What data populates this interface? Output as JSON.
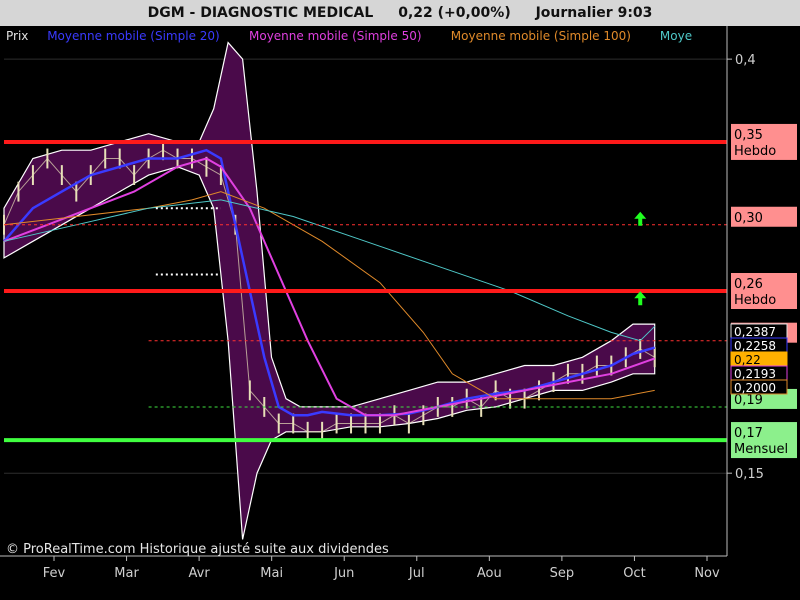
{
  "header": {
    "ticker": "DGM - DIAGNOSTIC MEDICAL",
    "price_change": "0,22 (+0,00%)",
    "interval_time": "Journalier  9:03"
  },
  "legend": [
    {
      "label": "Prix",
      "color": "#e0e0e0"
    },
    {
      "label": "Moyenne mobile (Simple 20)",
      "color": "#3a3aff"
    },
    {
      "label": "Moyenne mobile (Simple 50)",
      "color": "#e040e0"
    },
    {
      "label": "Moyenne mobile (Simple 100)",
      "color": "#e08a2a"
    },
    {
      "label": "Moye",
      "color": "#4fc8c8"
    }
  ],
  "copyright": "© ProRealTime.com Historique ajusté suite aux dividendes",
  "chart_data": {
    "type": "line",
    "ylim": [
      0.1,
      0.42
    ],
    "y_ticks": [
      {
        "value": 0.4,
        "label": "0,4"
      },
      {
        "value": 0.15,
        "label": "0,15"
      }
    ],
    "x_ticks": [
      "Fev",
      "Mar",
      "Avr",
      "Mai",
      "Jun",
      "Jul",
      "Aou",
      "Sep",
      "Oct",
      "Nov"
    ],
    "levels": [
      {
        "value": 0.35,
        "label": "0,35",
        "sublabel": "Hebdo",
        "style": "solid",
        "color": "#ff1a1a",
        "tag_bg": "#ff8f8f"
      },
      {
        "value": 0.3,
        "label": "0,30",
        "sublabel": "",
        "style": "dotted",
        "color": "#ff3030",
        "tag_bg": "#ff8f8f"
      },
      {
        "value": 0.26,
        "label": "0,26",
        "sublabel": "Hebdo",
        "style": "solid",
        "color": "#ff1a1a",
        "tag_bg": "#ff8f8f"
      },
      {
        "value": 0.23,
        "label": "0,23",
        "sublabel": "",
        "style": "dotted",
        "color": "#ff3030",
        "tag_bg": "#ff8f8f"
      },
      {
        "value": 0.19,
        "label": "0,19",
        "sublabel": "",
        "style": "dotted",
        "color": "#40e040",
        "tag_bg": "#8cf08c"
      },
      {
        "value": 0.17,
        "label": "0,17",
        "sublabel": "Mensuel",
        "style": "solid",
        "color": "#40ff40",
        "tag_bg": "#8cf08c"
      }
    ],
    "white_dotted": [
      {
        "value": 0.31,
        "from": 0.21,
        "to": 0.3
      },
      {
        "value": 0.27,
        "from": 0.21,
        "to": 0.3
      }
    ],
    "value_tags": [
      {
        "value": 0.2387,
        "label": "0,2387",
        "bg": "#000",
        "color": "#ffffff",
        "border": "#e0e0e0"
      },
      {
        "value": 0.2258,
        "label": "0,2258",
        "bg": "#000",
        "color": "#ffffff",
        "border": "#3a3aff"
      },
      {
        "value": 0.22,
        "label": "0,22",
        "bg": "#ffb000",
        "color": "#000000",
        "border": "#ffb000"
      },
      {
        "value": 0.2193,
        "label": "0,2193",
        "bg": "#000",
        "color": "#ffffff",
        "border": "#e040e0"
      },
      {
        "value": 0.2,
        "label": "0,2000",
        "bg": "#000",
        "color": "#ffffff",
        "border": "#e08a2a"
      }
    ],
    "arrows": [
      {
        "x": 0.88,
        "value": 0.303
      },
      {
        "x": 0.88,
        "value": 0.255
      }
    ],
    "price": {
      "color": "#e8e0b8",
      "x": [
        0,
        0.02,
        0.04,
        0.06,
        0.08,
        0.1,
        0.12,
        0.14,
        0.16,
        0.18,
        0.2,
        0.22,
        0.24,
        0.26,
        0.28,
        0.3,
        0.32,
        0.34,
        0.36,
        0.38,
        0.4,
        0.42,
        0.44,
        0.46,
        0.48,
        0.5,
        0.52,
        0.54,
        0.56,
        0.58,
        0.6,
        0.62,
        0.64,
        0.66,
        0.68,
        0.7,
        0.72,
        0.74,
        0.76,
        0.78,
        0.8,
        0.82,
        0.84,
        0.86,
        0.88,
        0.9
      ],
      "close": [
        0.3,
        0.32,
        0.33,
        0.34,
        0.33,
        0.32,
        0.33,
        0.34,
        0.34,
        0.33,
        0.34,
        0.345,
        0.34,
        0.34,
        0.335,
        0.33,
        0.3,
        0.2,
        0.19,
        0.18,
        0.18,
        0.175,
        0.175,
        0.18,
        0.18,
        0.18,
        0.18,
        0.185,
        0.18,
        0.185,
        0.19,
        0.19,
        0.195,
        0.19,
        0.2,
        0.195,
        0.195,
        0.2,
        0.205,
        0.21,
        0.21,
        0.215,
        0.215,
        0.22,
        0.225,
        0.22
      ]
    },
    "series": [
      {
        "name": "Moyenne mobile (Simple 20)",
        "color": "#3a3aff",
        "width": 2.5,
        "x": [
          0,
          0.04,
          0.08,
          0.12,
          0.16,
          0.2,
          0.24,
          0.28,
          0.3,
          0.32,
          0.34,
          0.36,
          0.38,
          0.4,
          0.42,
          0.44,
          0.48,
          0.52,
          0.56,
          0.6,
          0.64,
          0.68,
          0.72,
          0.76,
          0.8,
          0.84,
          0.87,
          0.9
        ],
        "values": [
          0.29,
          0.31,
          0.32,
          0.33,
          0.335,
          0.34,
          0.34,
          0.345,
          0.34,
          0.3,
          0.26,
          0.22,
          0.19,
          0.185,
          0.185,
          0.187,
          0.185,
          0.185,
          0.186,
          0.19,
          0.195,
          0.198,
          0.2,
          0.205,
          0.21,
          0.215,
          0.222,
          0.2258
        ]
      },
      {
        "name": "Moyenne mobile (Simple 50)",
        "color": "#e040e0",
        "width": 2,
        "x": [
          0,
          0.06,
          0.12,
          0.18,
          0.24,
          0.28,
          0.3,
          0.34,
          0.38,
          0.42,
          0.46,
          0.5,
          0.54,
          0.6,
          0.66,
          0.72,
          0.78,
          0.84,
          0.9
        ],
        "values": [
          0.29,
          0.3,
          0.31,
          0.32,
          0.335,
          0.34,
          0.335,
          0.31,
          0.27,
          0.23,
          0.195,
          0.185,
          0.185,
          0.19,
          0.195,
          0.2,
          0.205,
          0.21,
          0.2193
        ]
      },
      {
        "name": "Moyenne mobile (Simple 100)",
        "color": "#e08a2a",
        "width": 1,
        "x": [
          0,
          0.1,
          0.2,
          0.26,
          0.3,
          0.36,
          0.44,
          0.52,
          0.58,
          0.62,
          0.68,
          0.76,
          0.84,
          0.9
        ],
        "values": [
          0.3,
          0.305,
          0.31,
          0.315,
          0.32,
          0.31,
          0.29,
          0.265,
          0.235,
          0.21,
          0.195,
          0.195,
          0.195,
          0.2
        ]
      },
      {
        "name": "Moye",
        "color": "#4fc8c8",
        "width": 1,
        "x": [
          0,
          0.1,
          0.2,
          0.3,
          0.4,
          0.5,
          0.6,
          0.7,
          0.78,
          0.84,
          0.88,
          0.9
        ],
        "values": [
          0.29,
          0.3,
          0.31,
          0.315,
          0.305,
          0.29,
          0.275,
          0.26,
          0.245,
          0.235,
          0.23,
          0.2387
        ]
      }
    ],
    "bollinger": {
      "color": "#4a0a4a",
      "stroke": "#ffffff",
      "x": [
        0,
        0.04,
        0.08,
        0.12,
        0.16,
        0.2,
        0.24,
        0.27,
        0.29,
        0.31,
        0.33,
        0.35,
        0.37,
        0.39,
        0.41,
        0.44,
        0.48,
        0.52,
        0.56,
        0.6,
        0.64,
        0.68,
        0.72,
        0.76,
        0.8,
        0.84,
        0.87,
        0.9
      ],
      "upper": [
        0.31,
        0.34,
        0.345,
        0.345,
        0.35,
        0.355,
        0.35,
        0.35,
        0.37,
        0.41,
        0.4,
        0.32,
        0.22,
        0.195,
        0.19,
        0.19,
        0.19,
        0.195,
        0.2,
        0.205,
        0.205,
        0.21,
        0.215,
        0.215,
        0.22,
        0.23,
        0.24,
        0.24
      ],
      "lower": [
        0.28,
        0.29,
        0.3,
        0.31,
        0.32,
        0.33,
        0.335,
        0.33,
        0.31,
        0.23,
        0.11,
        0.15,
        0.17,
        0.175,
        0.175,
        0.175,
        0.178,
        0.178,
        0.18,
        0.183,
        0.188,
        0.19,
        0.195,
        0.2,
        0.2,
        0.205,
        0.21,
        0.21
      ]
    }
  }
}
